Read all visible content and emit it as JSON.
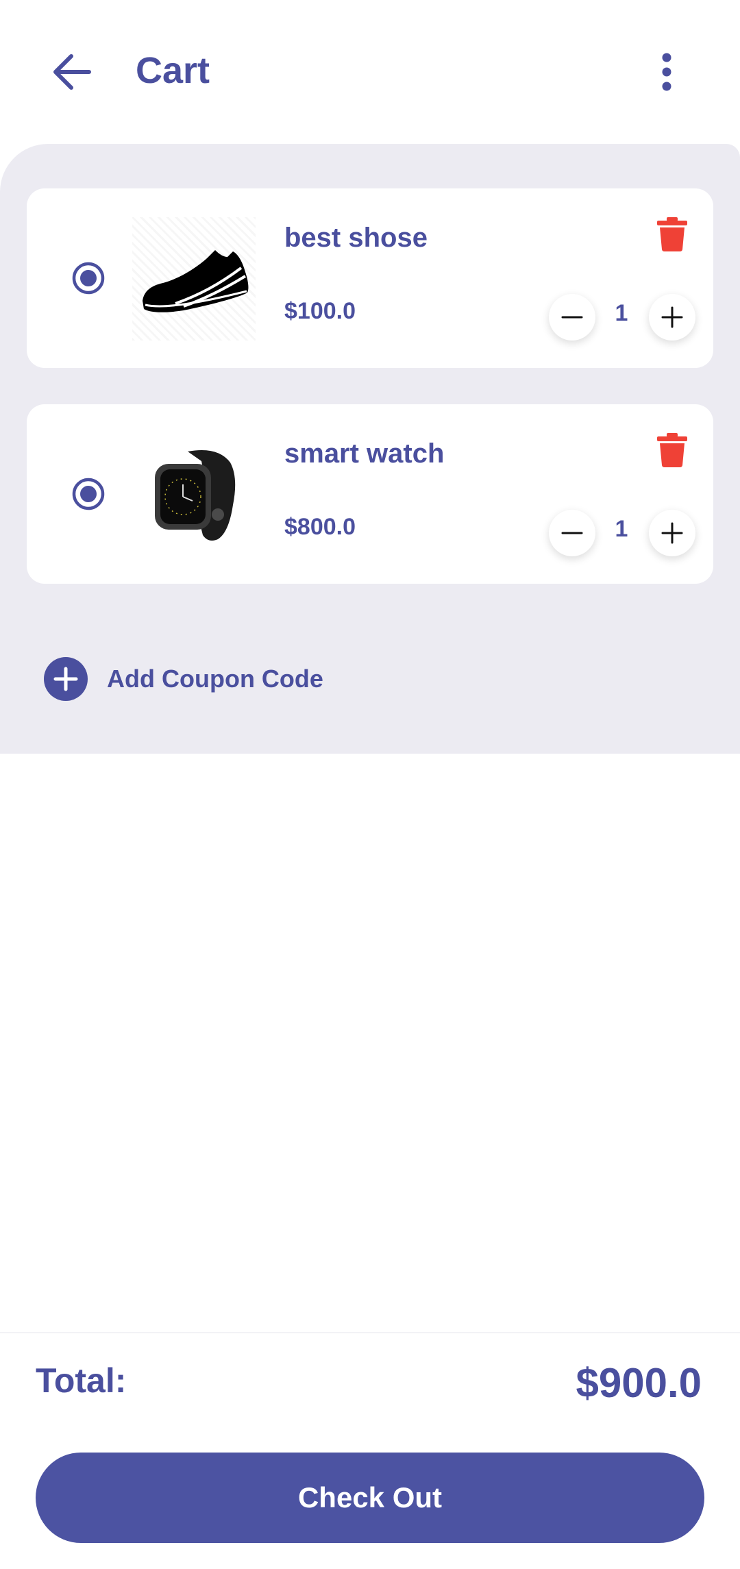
{
  "header": {
    "title": "Cart"
  },
  "cart": {
    "items": [
      {
        "name": "best shose",
        "price": "$100.0",
        "quantity": "1",
        "image_icon": "sneaker-image",
        "selected": true
      },
      {
        "name": "smart watch",
        "price": "$800.0",
        "quantity": "1",
        "image_icon": "smartwatch-image",
        "selected": true
      }
    ],
    "coupon_label": "Add Coupon Code"
  },
  "summary": {
    "total_label": "Total:",
    "total_value": "$900.0",
    "checkout_label": "Check Out"
  },
  "colors": {
    "primary": "#4a4f9e",
    "button": "#4c53a2",
    "delete": "#ef4136",
    "panel_bg": "#ecebf2"
  }
}
